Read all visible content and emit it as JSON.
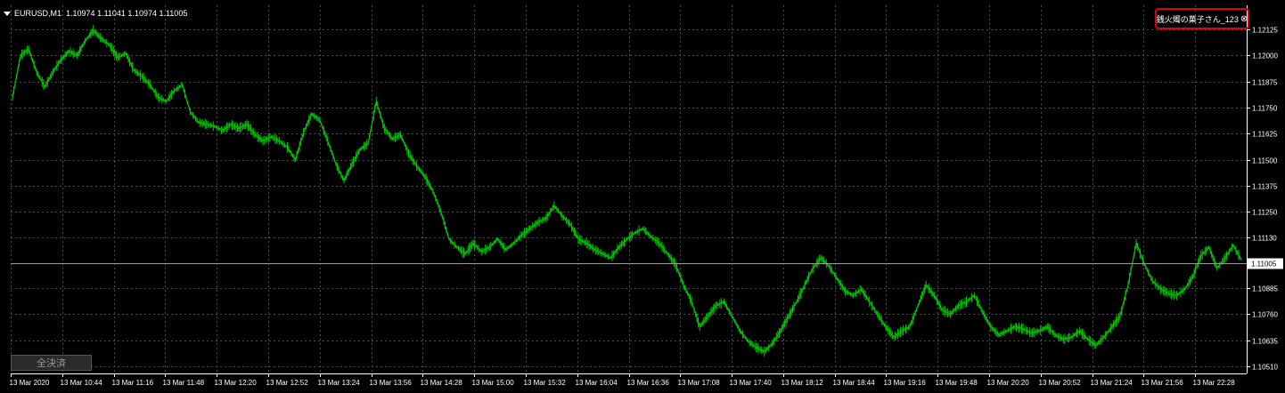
{
  "header": {
    "symbol": "EURUSD,M1",
    "ohlc": "1.10974 1.11041 1.10974 1.11005"
  },
  "badge": {
    "label": "銭火燭の菓子さん_123",
    "close_glyph": "⊗"
  },
  "close_all_button": {
    "label": "全決済"
  },
  "colors": {
    "background": "#000000",
    "candle": "#00c800",
    "grid": "#4b4b4b",
    "axis": "#ffffff",
    "badge_border": "#e00010"
  },
  "chart_data": {
    "type": "line",
    "title": "",
    "xlabel": "",
    "ylabel": "",
    "ylim": [
      1.1051,
      1.1215
    ],
    "grid": true,
    "current_price": 1.11005,
    "y_ticks": [
      "1.12125",
      "1.12000",
      "1.11875",
      "1.11750",
      "1.11625",
      "1.11500",
      "1.11375",
      "1.11250",
      "1.11130",
      "1.11005",
      "1.10885",
      "1.10760",
      "1.10635",
      "1.10510"
    ],
    "x_ticks": [
      "13 Mar 2020",
      "13 Mar 10:44",
      "13 Mar 11:16",
      "13 Mar 11:48",
      "13 Mar 12:20",
      "13 Mar 12:52",
      "13 Mar 13:24",
      "13 Mar 13:56",
      "13 Mar 14:28",
      "13 Mar 15:00",
      "13 Mar 15:32",
      "13 Mar 16:04",
      "13 Mar 16:36",
      "13 Mar 17:08",
      "13 Mar 17:40",
      "13 Mar 18:12",
      "13 Mar 18:44",
      "13 Mar 19:16",
      "13 Mar 19:48",
      "13 Mar 20:20",
      "13 Mar 20:52",
      "13 Mar 21:24",
      "13 Mar 21:56",
      "13 Mar 22:28"
    ],
    "series": [
      {
        "values": [
          1.118,
          1.12,
          1.1203,
          1.1192,
          1.1185,
          1.1192,
          1.1198,
          1.1202,
          1.12,
          1.1207,
          1.1212,
          1.1208,
          1.1205,
          1.1199,
          1.1201,
          1.1193,
          1.119,
          1.1186,
          1.118,
          1.1178,
          1.1183,
          1.1186,
          1.1173,
          1.1168,
          1.1167,
          1.1166,
          1.1164,
          1.1167,
          1.1165,
          1.1167,
          1.1162,
          1.1159,
          1.1161,
          1.1159,
          1.1156,
          1.115,
          1.1163,
          1.1172,
          1.1169,
          1.1159,
          1.1148,
          1.114,
          1.1148,
          1.1155,
          1.1158,
          1.1178,
          1.1165,
          1.116,
          1.1162,
          1.1153,
          1.1147,
          1.1142,
          1.1135,
          1.1125,
          1.1112,
          1.1108,
          1.1105,
          1.111,
          1.1106,
          1.1108,
          1.1112,
          1.1107,
          1.111,
          1.1114,
          1.1117,
          1.112,
          1.1122,
          1.1128,
          1.1123,
          1.1119,
          1.1112,
          1.111,
          1.1107,
          1.1105,
          1.1103,
          1.1108,
          1.1112,
          1.1115,
          1.1117,
          1.1113,
          1.111,
          1.1105,
          1.11,
          1.109,
          1.1082,
          1.107,
          1.1075,
          1.108,
          1.1082,
          1.1075,
          1.1068,
          1.1063,
          1.106,
          1.1058,
          1.1062,
          1.1068,
          1.1075,
          1.1082,
          1.109,
          1.1098,
          1.1103,
          1.1099,
          1.1093,
          1.1087,
          1.1085,
          1.1088,
          1.1082,
          1.1076,
          1.107,
          1.1065,
          1.1068,
          1.107,
          1.108,
          1.109,
          1.1085,
          1.1078,
          1.1076,
          1.108,
          1.1082,
          1.1085,
          1.1077,
          1.107,
          1.1066,
          1.1068,
          1.107,
          1.1069,
          1.1067,
          1.1068,
          1.107,
          1.1066,
          1.1064,
          1.1065,
          1.1068,
          1.1064,
          1.1061,
          1.1065,
          1.107,
          1.1075,
          1.109,
          1.111,
          1.11,
          1.1092,
          1.1088,
          1.1086,
          1.1085,
          1.1088,
          1.1094,
          1.1104,
          1.1108,
          1.1098,
          1.1103,
          1.1109,
          1.1102
        ]
      }
    ]
  }
}
